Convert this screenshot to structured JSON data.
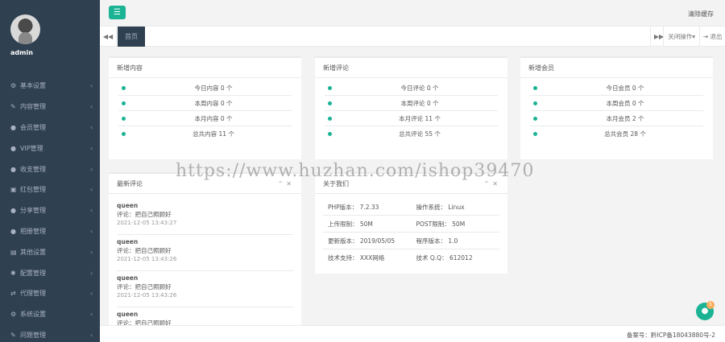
{
  "sidebar": {
    "username": "admin",
    "items": [
      {
        "icon": "gear-icon",
        "glyph": "⚙",
        "label": "基本设置"
      },
      {
        "icon": "edit-icon",
        "glyph": "✎",
        "label": "内容管理"
      },
      {
        "icon": "users-icon",
        "glyph": "●",
        "label": "会员管理"
      },
      {
        "icon": "user-icon",
        "glyph": "●",
        "label": "VIP管理"
      },
      {
        "icon": "user-icon",
        "glyph": "●",
        "label": "收支管理"
      },
      {
        "icon": "gift-icon",
        "glyph": "▣",
        "label": "红包管理"
      },
      {
        "icon": "user-icon",
        "glyph": "●",
        "label": "分享管理"
      },
      {
        "icon": "user-icon",
        "glyph": "●",
        "label": "相册管理"
      },
      {
        "icon": "gear-icon",
        "glyph": "▤",
        "label": "其他设置"
      },
      {
        "icon": "star-icon",
        "glyph": "✱",
        "label": "配置管理"
      },
      {
        "icon": "transfer-icon",
        "glyph": "⇄",
        "label": "代理管理"
      },
      {
        "icon": "cogs-icon",
        "glyph": "⚙",
        "label": "系统设置"
      },
      {
        "icon": "edit-icon",
        "glyph": "✎",
        "label": "问题管理"
      }
    ]
  },
  "topbar": {
    "clear_cache": "清除缓存"
  },
  "tabbar": {
    "home_tab": "首页",
    "close_ops": "关闭操作▾",
    "logout": "退出"
  },
  "panels": {
    "new_content": {
      "title": "新增内容",
      "rows": [
        "今日内容 0 个",
        "本周内容 0 个",
        "本月内容 0 个",
        "总共内容 11 个"
      ]
    },
    "new_comments": {
      "title": "新增评论",
      "rows": [
        "今日评论 0 个",
        "本周评论 0 个",
        "本月评论 11 个",
        "总共评论 55 个"
      ]
    },
    "new_members": {
      "title": "新增会员",
      "rows": [
        "今日会员 0 个",
        "本周会员 0 个",
        "本月会员 2 个",
        "总共会员 28 个"
      ]
    },
    "latest_comments": {
      "title": "最新评论",
      "items": [
        {
          "user": "queen",
          "text": "评论：把自己照顾好",
          "time": "2021-12-05 13:43:27"
        },
        {
          "user": "queen",
          "text": "评论：把自己照顾好",
          "time": "2021-12-05 13:43:26"
        },
        {
          "user": "queen",
          "text": "评论：把自己照顾好",
          "time": "2021-12-05 13:43:26"
        },
        {
          "user": "queen",
          "text": "评论：把自己照顾好",
          "time": ""
        }
      ]
    },
    "about_system": {
      "title": "关于我们",
      "rows": [
        [
          "PHP版本：  7.2.33",
          "操作系统：  Linux"
        ],
        [
          "上传限制：  50M",
          "POST限制：  50M"
        ],
        [
          "更新版本：  2019/05/05",
          "程序版本：  1.0"
        ],
        [
          "技术支持：  XXX网络",
          "技术 Q.Q：  612012"
        ]
      ]
    }
  },
  "footer": {
    "icp": "备案号：黔ICP备18043880号-2"
  },
  "chat": {
    "badge": "5"
  },
  "watermark": "https://www.huzhan.com/ishop39470",
  "colors": {
    "sidebar": "#2f4050",
    "accent": "#1ab394"
  }
}
